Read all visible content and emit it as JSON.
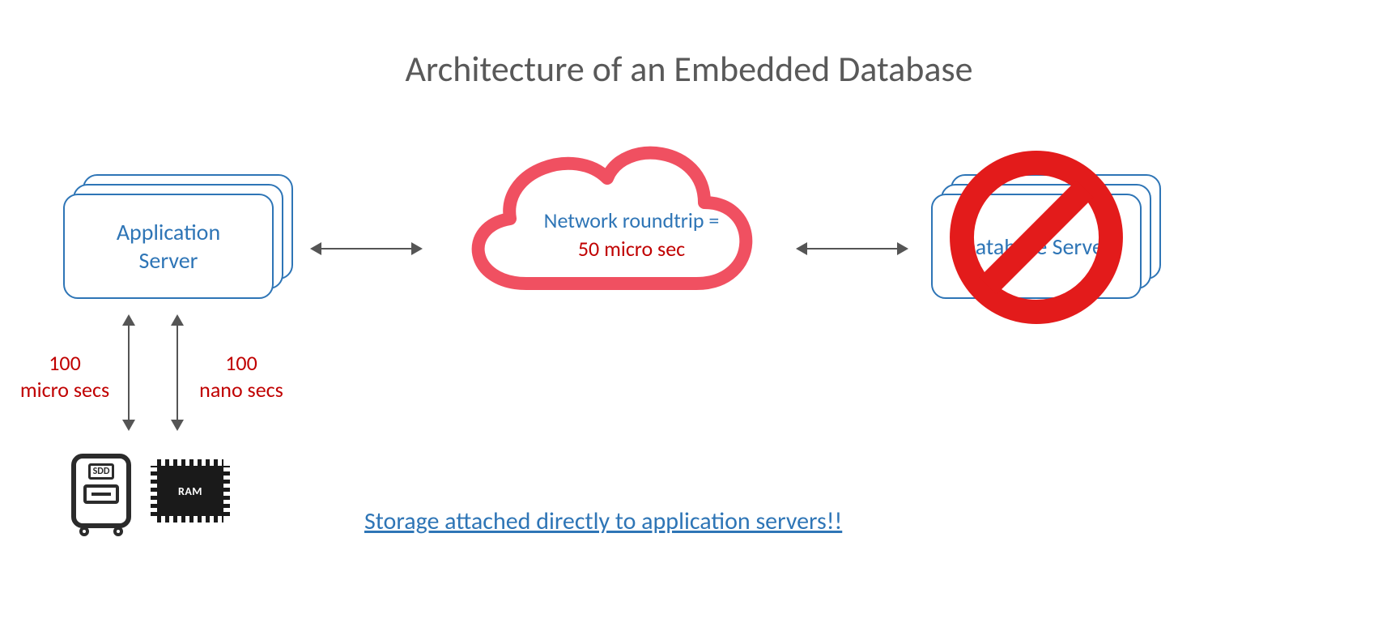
{
  "title": "Architecture of an Embedded Database",
  "app_server": {
    "label": "Application\nServer"
  },
  "db_server": {
    "label": "Database Server"
  },
  "cloud": {
    "line1": "Network roundtrip =",
    "line2": "50 micro sec"
  },
  "latency": {
    "ssd": "100\nmicro secs",
    "ram": "100\nnano secs"
  },
  "storage": {
    "ssd_label": "SDD",
    "ram_label": "RAM"
  },
  "caption": "Storage attached directly to application servers!!",
  "icons": {
    "cloud": "cloud-icon",
    "no": "no-entry-icon",
    "ssd": "ssd-icon",
    "ram": "ram-chip-icon",
    "harrow": "double-h-arrow-icon",
    "varrow": "double-v-arrow-icon"
  }
}
